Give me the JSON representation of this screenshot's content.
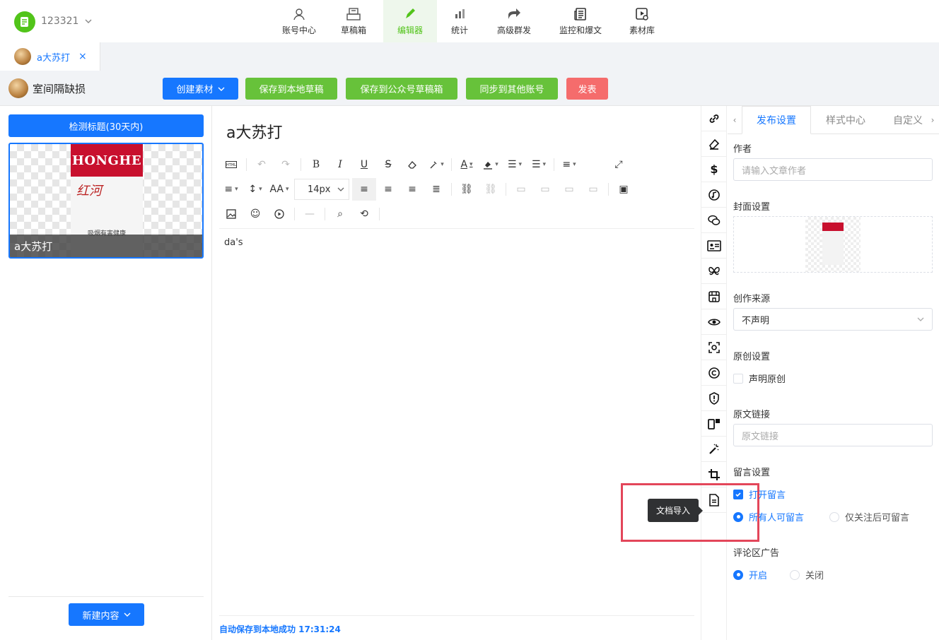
{
  "header": {
    "account": "123321",
    "nav": [
      {
        "label": "账号中心",
        "icon": "user-icon",
        "active": false
      },
      {
        "label": "草稿箱",
        "icon": "drafts-icon",
        "active": false
      },
      {
        "label": "编辑器",
        "icon": "pen-icon",
        "active": true
      },
      {
        "label": "统计",
        "icon": "stats-icon",
        "active": false
      },
      {
        "label": "高级群发",
        "icon": "share-icon",
        "active": false
      },
      {
        "label": "监控和爆文",
        "icon": "news-icon",
        "active": false
      },
      {
        "label": "素材库",
        "icon": "media-library-icon",
        "active": false
      }
    ],
    "accent": "#52c41a"
  },
  "tabs": [
    {
      "label": "a大苏打",
      "close": "×"
    }
  ],
  "toolbar": {
    "owner": "室间隔缺损",
    "create_label": "创建素材",
    "save_local_label": "保存到本地草稿",
    "save_mp_label": "保存到公众号草稿箱",
    "sync_label": "同步到其他账号",
    "publish_label": "发表",
    "colors": {
      "primary": "#1677ff",
      "green": "#67c23a",
      "danger": "#f56c6c"
    }
  },
  "left": {
    "detect_label": "检测标题(30天内)",
    "card_title": "a大苏打",
    "new_label": "新建内容"
  },
  "editor": {
    "title": "a大苏打",
    "font_size": "14px",
    "body": "da's",
    "autosave": "自动保存到本地成功 17:31:24"
  },
  "tooltip": "文档导入",
  "right": {
    "tabs": [
      "发布设置",
      "样式中心",
      "自定义"
    ],
    "author_label": "作者",
    "author_placeholder": "请输入文章作者",
    "cover_label": "封面设置",
    "source_label": "创作来源",
    "source_value": "不声明",
    "original_label": "原创设置",
    "original_option": "声明原创",
    "link_label": "原文链接",
    "link_placeholder": "原文链接",
    "comment_label": "留言设置",
    "comment_open": "打开留言",
    "comment_all": "所有人可留言",
    "comment_followers": "仅关注后可留言",
    "ad_label": "评论区广告",
    "ad_on": "开启",
    "ad_off": "关闭"
  }
}
